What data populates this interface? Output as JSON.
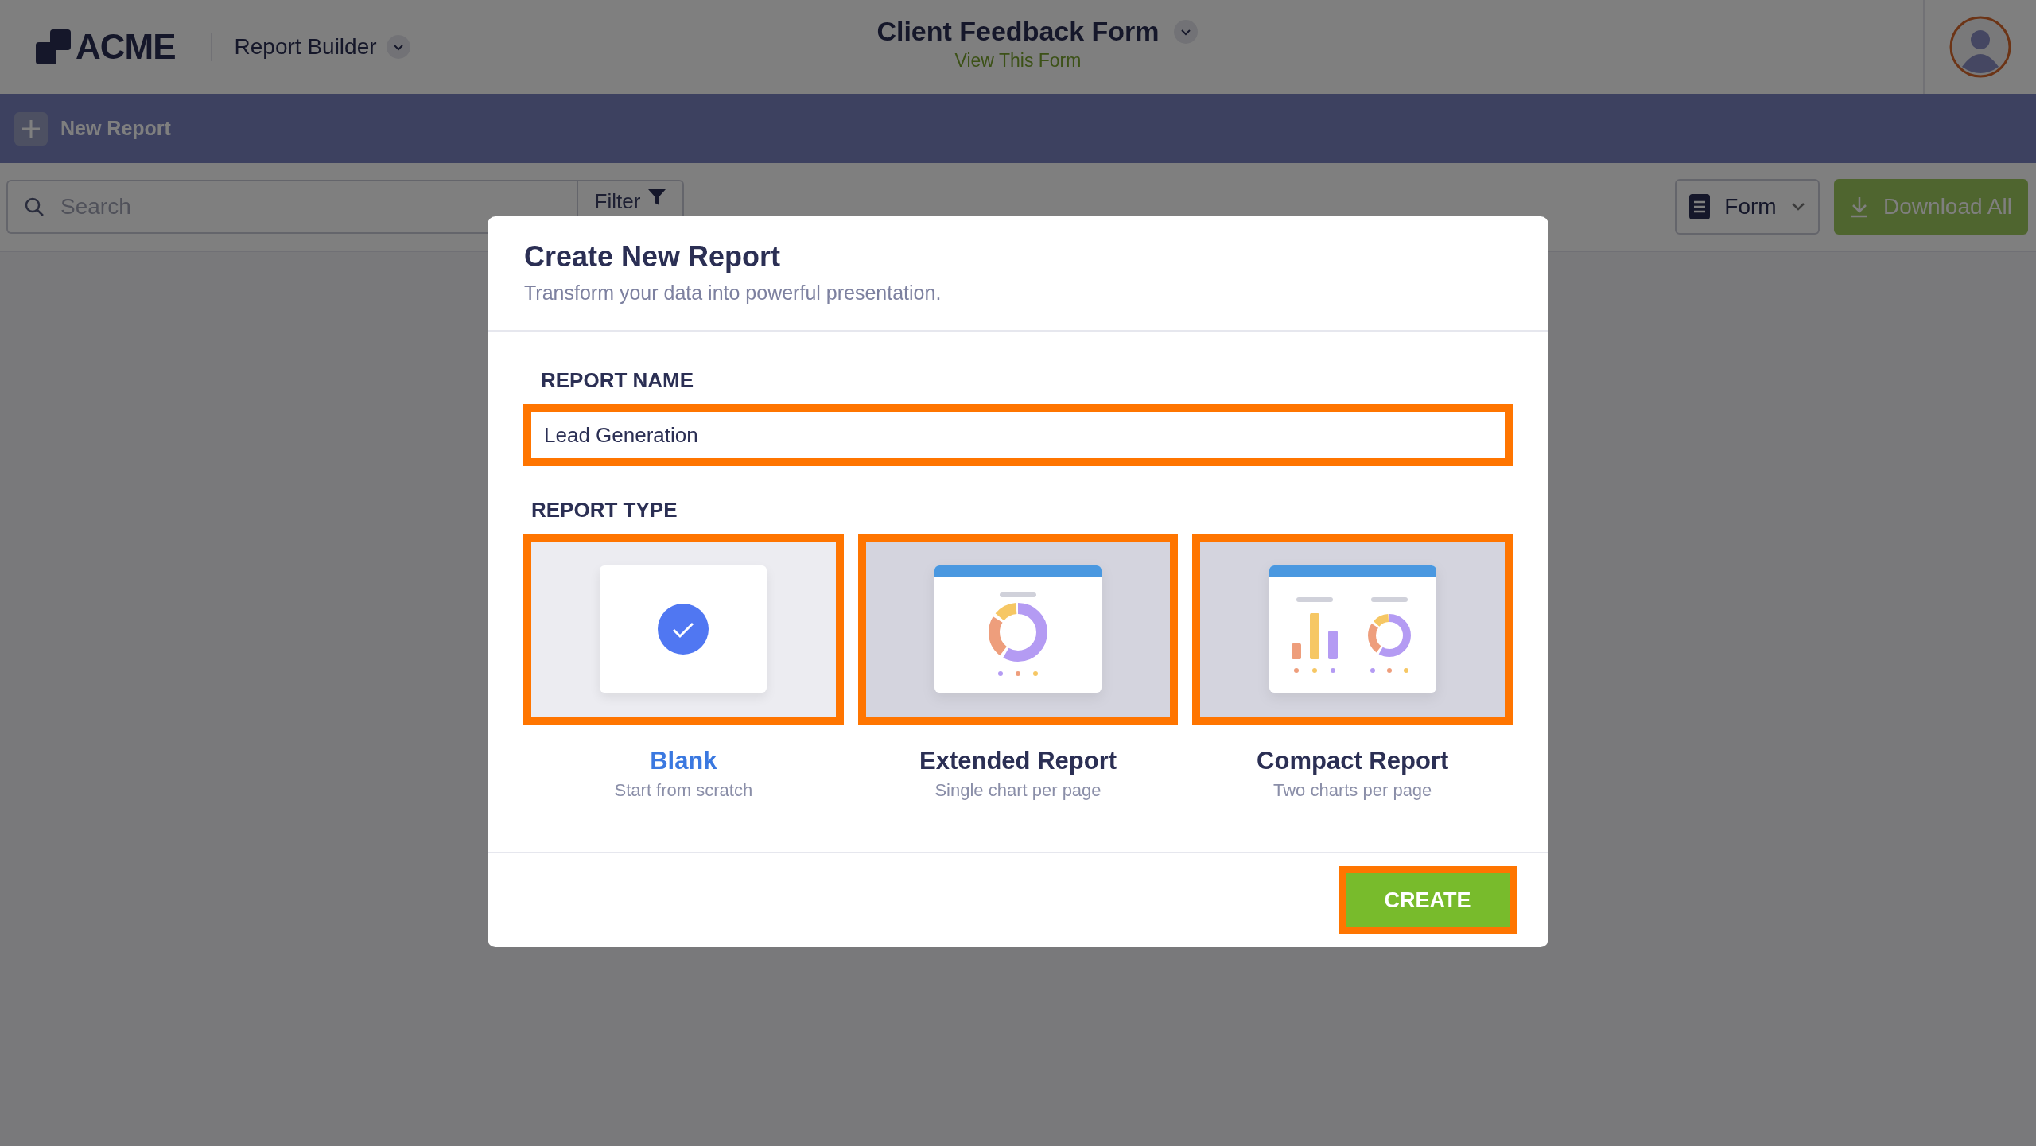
{
  "header": {
    "logo": "ACME",
    "app_menu": "Report Builder",
    "form_title": "Client Feedback Form",
    "form_link": "View This Form"
  },
  "toolbar": {
    "new_button": "New Report"
  },
  "filters": {
    "search": {
      "placeholder": "Search"
    },
    "filter_button": "Filter",
    "form_dropdown": "Form",
    "download_button": "Download All"
  },
  "dialog": {
    "title": "Create New Report",
    "subtitle": "Transform your data into powerful presentation.",
    "name_label": "REPORT NAME",
    "name_value": "Lead Generation",
    "type_label": "REPORT TYPE",
    "types": [
      {
        "kind": "blank",
        "title": "Blank",
        "description": "Start from scratch",
        "selected": true
      },
      {
        "kind": "extended",
        "title": "Extended Report",
        "description": "Single chart per page",
        "selected": false
      },
      {
        "kind": "compact",
        "title": "Compact Report",
        "description": "Two charts per page",
        "selected": false
      }
    ],
    "create_button": "CREATE"
  }
}
